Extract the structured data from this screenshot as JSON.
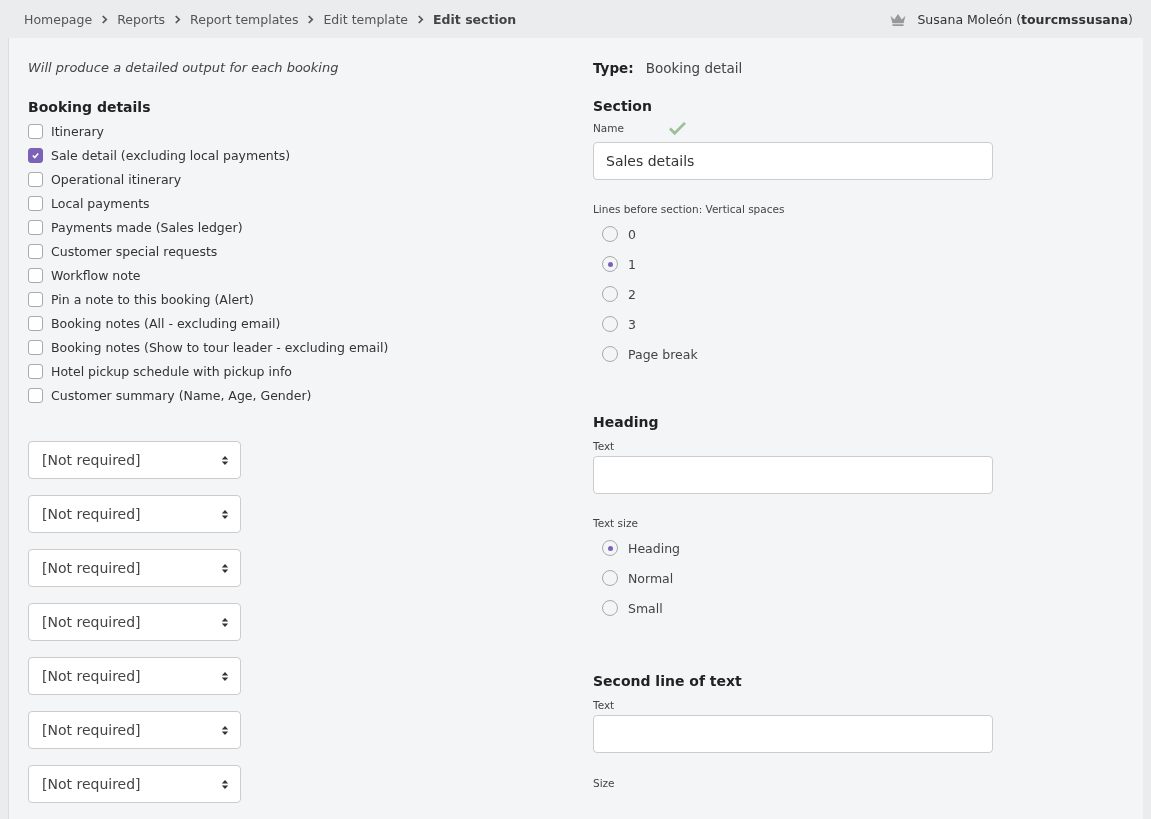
{
  "breadcrumb": [
    {
      "label": "Homepage",
      "current": false
    },
    {
      "label": "Reports",
      "current": false
    },
    {
      "label": "Report templates",
      "current": false
    },
    {
      "label": "Edit template",
      "current": false
    },
    {
      "label": "Edit section",
      "current": true
    }
  ],
  "user": {
    "name": "Susana Moleón (",
    "username": "tourcmssusana",
    "suffix": ")"
  },
  "description": "Will produce a detailed output for each booking",
  "booking_details": {
    "title": "Booking details",
    "items": [
      {
        "label": "Itinerary",
        "checked": false
      },
      {
        "label": "Sale detail (excluding local payments)",
        "checked": true
      },
      {
        "label": "Operational itinerary",
        "checked": false
      },
      {
        "label": "Local payments",
        "checked": false
      },
      {
        "label": "Payments made (Sales ledger)",
        "checked": false
      },
      {
        "label": "Customer special requests",
        "checked": false
      },
      {
        "label": "Workflow note",
        "checked": false
      },
      {
        "label": "Pin a note to this booking (Alert)",
        "checked": false
      },
      {
        "label": "Booking notes (All - excluding email)",
        "checked": false
      },
      {
        "label": "Booking notes (Show to tour leader - excluding email)",
        "checked": false
      },
      {
        "label": "Hotel pickup schedule with pickup info",
        "checked": false
      },
      {
        "label": "Customer summary (Name, Age, Gender)",
        "checked": false
      }
    ]
  },
  "selects": [
    "[Not required]",
    "[Not required]",
    "[Not required]",
    "[Not required]",
    "[Not required]",
    "[Not required]",
    "[Not required]"
  ],
  "type": {
    "label": "Type:",
    "value": "Booking detail"
  },
  "section": {
    "title": "Section",
    "name_label": "Name",
    "name_valid": true,
    "name_value": "Sales details",
    "lines_label": "Lines before section: Vertical spaces",
    "lines_options": [
      {
        "label": "0",
        "selected": false
      },
      {
        "label": "1",
        "selected": true
      },
      {
        "label": "2",
        "selected": false
      },
      {
        "label": "3",
        "selected": false
      },
      {
        "label": "Page break",
        "selected": false
      }
    ]
  },
  "heading": {
    "title": "Heading",
    "text_label": "Text",
    "size_label": "Text size",
    "size_options": [
      {
        "label": "Heading",
        "selected": true
      },
      {
        "label": "Normal",
        "selected": false
      },
      {
        "label": "Small",
        "selected": false
      }
    ]
  },
  "second_line": {
    "title": "Second line of text",
    "text_label": "Text",
    "size_label": "Size"
  }
}
